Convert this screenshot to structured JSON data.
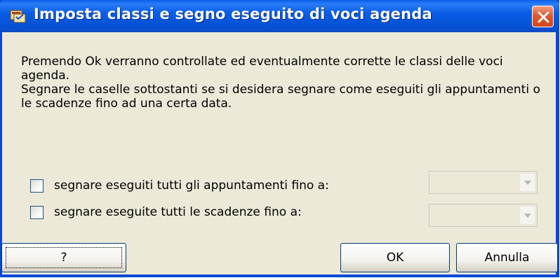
{
  "window": {
    "title": "Imposta classi e segno eseguito di voci agenda",
    "icon": "app-icon"
  },
  "message": {
    "line1": "Premendo Ok verranno controllate ed eventualmente corrette le classi delle voci agenda.",
    "line2": "Segnare le caselle sottostanti se si desidera segnare come eseguiti gli appuntamenti o le scadenze fino ad una certa data."
  },
  "options": [
    {
      "label": "segnare eseguiti tutti gli appuntamenti fino a:",
      "checked": false,
      "date_value": ""
    },
    {
      "label": "segnare eseguite tutti le scadenze fino a:",
      "checked": false,
      "date_value": ""
    }
  ],
  "buttons": {
    "help": "?",
    "ok": "OK",
    "cancel": "Annulla"
  },
  "colors": {
    "titlebar": "#0553d6",
    "close": "#e2582e",
    "dialog_bg": "#ece9d8"
  }
}
